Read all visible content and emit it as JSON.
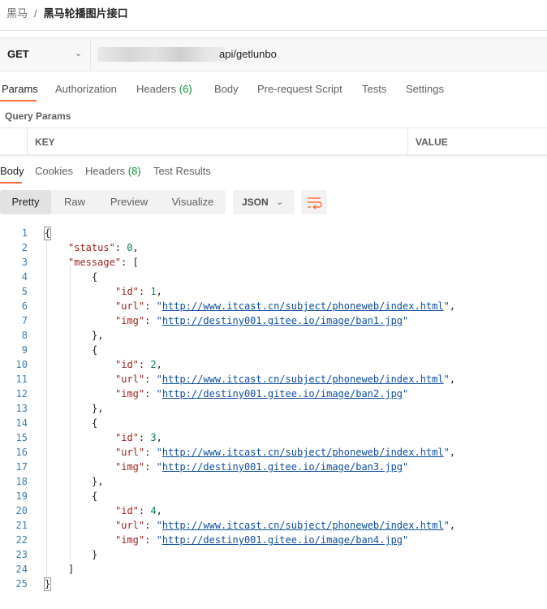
{
  "breadcrumb": {
    "parent": "黑马",
    "separator": "/",
    "current": "黑马轮播图片接口"
  },
  "request": {
    "method": "GET",
    "url_visible": "api/getlunbo"
  },
  "request_tabs": [
    {
      "label": "Params",
      "active": true
    },
    {
      "label": "Authorization"
    },
    {
      "label": "Headers",
      "count": "(6)"
    },
    {
      "label": "Body"
    },
    {
      "label": "Pre-request Script"
    },
    {
      "label": "Tests"
    },
    {
      "label": "Settings"
    }
  ],
  "query_params": {
    "title": "Query Params",
    "columns": [
      "KEY",
      "VALUE"
    ]
  },
  "response_tabs": [
    {
      "label": "Body",
      "active": true
    },
    {
      "label": "Cookies"
    },
    {
      "label": "Headers",
      "count": "(8)"
    },
    {
      "label": "Test Results"
    }
  ],
  "view_modes": [
    "Pretty",
    "Raw",
    "Preview",
    "Visualize"
  ],
  "active_view": "Pretty",
  "format": "JSON",
  "icons": {
    "method_dropdown": "chevron-down-icon",
    "format_dropdown": "chevron-down-icon",
    "wrap": "wrap-lines-icon"
  },
  "colors": {
    "accent": "#ff6c37",
    "count": "#0a8f3a",
    "json_key": "#9c1f1f",
    "json_string": "#0e4f9e",
    "json_number": "#0b7a5b"
  },
  "response_json": {
    "status": 0,
    "message": [
      {
        "id": 1,
        "url": "http://www.itcast.cn/subject/phoneweb/index.html",
        "img": "http://destiny001.gitee.io/image/ban1.jpg"
      },
      {
        "id": 2,
        "url": "http://www.itcast.cn/subject/phoneweb/index.html",
        "img": "http://destiny001.gitee.io/image/ban2.jpg"
      },
      {
        "id": 3,
        "url": "http://www.itcast.cn/subject/phoneweb/index.html",
        "img": "http://destiny001.gitee.io/image/ban3.jpg"
      },
      {
        "id": 4,
        "url": "http://www.itcast.cn/subject/phoneweb/index.html",
        "img": "http://destiny001.gitee.io/image/ban4.jpg"
      }
    ]
  }
}
